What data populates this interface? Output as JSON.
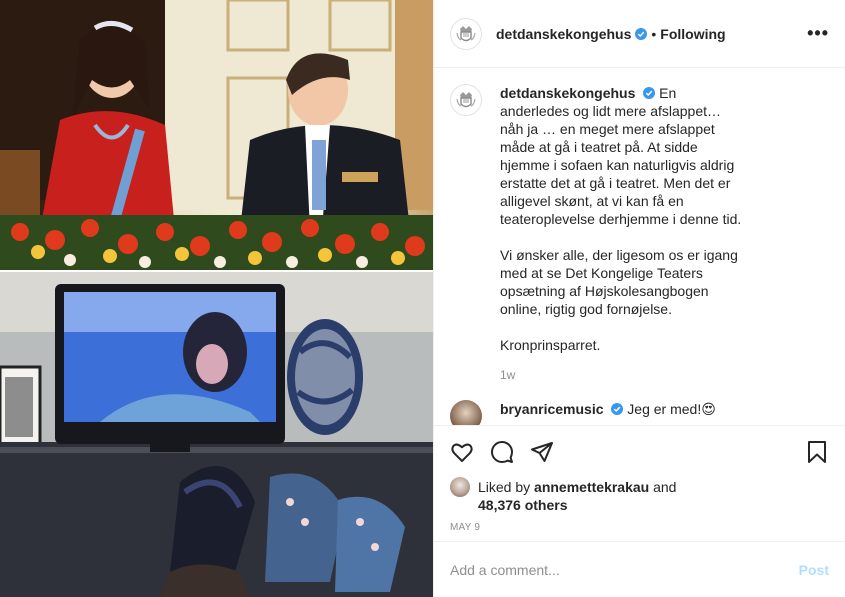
{
  "account": {
    "username": "detdanskekongehus",
    "verified": true,
    "follow_status": "Following"
  },
  "caption": {
    "username": "detdanskekongehus",
    "paragraphs": [
      "En anderledes og lidt mere afslappet… nåh ja … en meget mere afslappet måde at gå i teatret på. At sidde hjemme i sofaen kan naturligvis aldrig erstatte det at gå i teatret. Men det er alligevel skønt, at vi kan få en teateroplevelse derhjemme i denne tid.",
      "Vi ønsker alle, der ligesom os er igang med at se Det Kongelige Teaters opsætning af Højskolesangbogen online, rigtig god fornøjelse.",
      "Kronprinsparret."
    ],
    "time_ago": "1w"
  },
  "comments": [
    {
      "username": "bryanricemusic",
      "text": "Jeg er med!😍"
    }
  ],
  "likes": {
    "prefix": "Liked by",
    "liked_by": "annemettekrakau",
    "connector": "and",
    "others": "48,376 others"
  },
  "date": "MAY 9",
  "add_comment": {
    "placeholder": "Add a comment...",
    "post_label": "Post"
  },
  "colors": {
    "verified_blue": "#3897f0",
    "post_disabled": "#b2dffc",
    "muted_text": "#8e8e8e",
    "border": "#efefef"
  },
  "icons": {
    "more": "more-options-icon",
    "like": "heart-icon",
    "comment": "comment-bubble-icon",
    "share": "paper-plane-icon",
    "save": "bookmark-icon"
  }
}
